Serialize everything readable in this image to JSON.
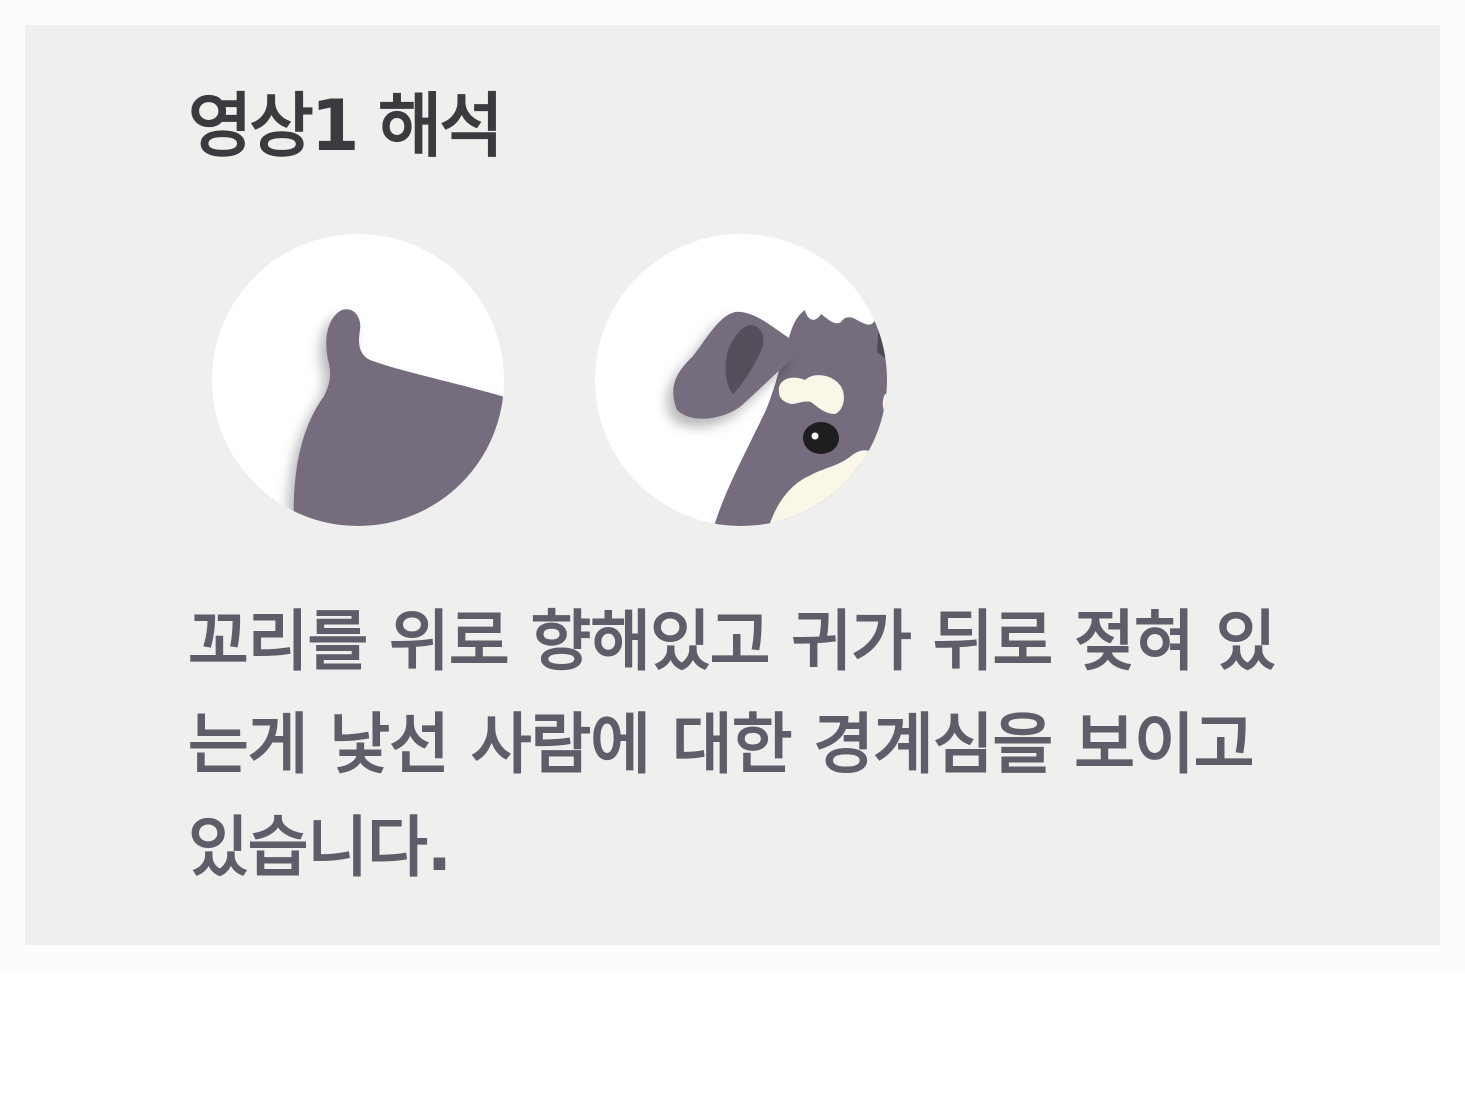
{
  "title": "영상1 해석",
  "illustrations": {
    "left": "dog-tail-raised-icon",
    "right": "dog-ears-back-icon"
  },
  "description": "꼬리를 위로 향해있고 귀가 뒤로 젖혀 있는게 낯선 사람에 대한 경계심을 보이고 있습니다.",
  "colors": {
    "card_background": "#efefed",
    "title_text": "#3b3a3e",
    "body_text": "#5f5d69",
    "dog_fur": "#756c7d",
    "dog_inner_ear": "#554f5b",
    "dog_markings": "#faf7e9"
  }
}
